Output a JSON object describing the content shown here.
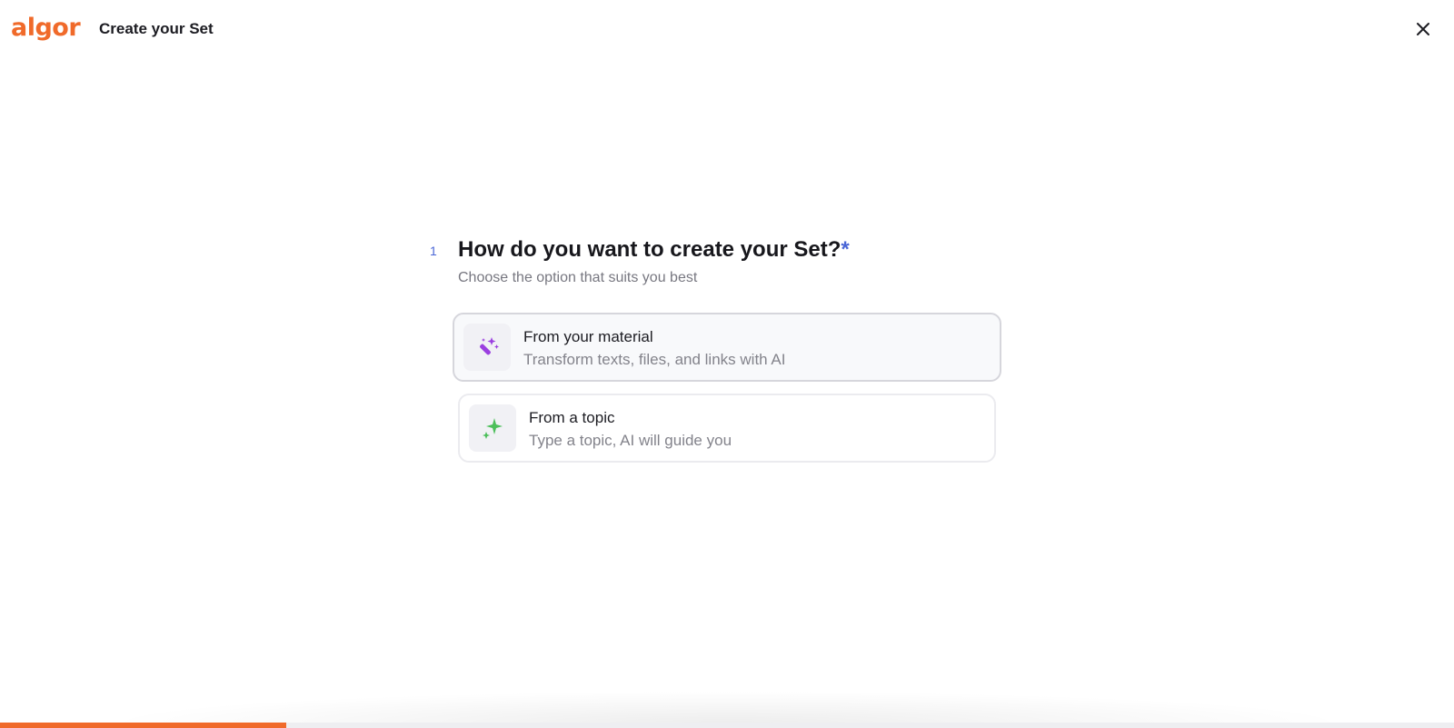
{
  "header": {
    "logo_text": "algor",
    "title": "Create your Set",
    "close_icon": "close-icon"
  },
  "question": {
    "number": "1",
    "title": "How do you want to create your Set?",
    "required_mark": "*",
    "subtitle": "Choose the option that suits you best"
  },
  "options": [
    {
      "title": "From your material",
      "description": "Transform texts, files, and links with AI",
      "icon": "magic-wand-icon",
      "icon_color": "#9b3fe0",
      "selected": true
    },
    {
      "title": "From a topic",
      "description": "Type a topic, AI will guide you",
      "icon": "sparkle-icon",
      "icon_color": "#4cbf5a",
      "selected": false
    }
  ],
  "progress": {
    "fraction": 0.197
  },
  "colors": {
    "brand": "#f06a2a",
    "accent": "#4a66d6"
  }
}
